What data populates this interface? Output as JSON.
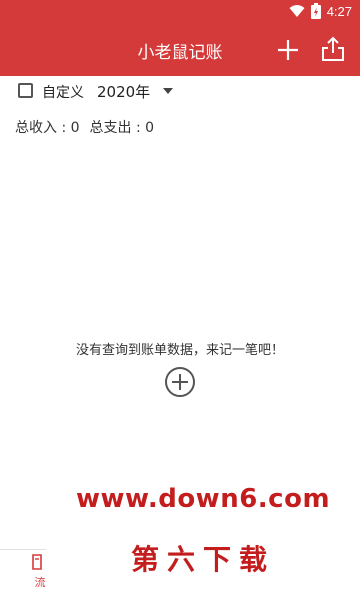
{
  "status_bar": {
    "time": "4:27",
    "battery_icon": "battery-charging-icon",
    "wifi_icon": "wifi-icon"
  },
  "app_bar": {
    "title": "小老鼠记账",
    "actions": [
      "add-icon",
      "share-upload-icon"
    ]
  },
  "filter": {
    "custom_label": "自定义",
    "year": "2020年",
    "checked": false
  },
  "summary": {
    "income": "总收入 : 0",
    "expense": "总支出 : 0"
  },
  "empty_state": {
    "message": "没有查询到账单数据，来记一笔吧！"
  },
  "bottom_nav": {
    "item_label": "流"
  },
  "watermark": {
    "line1": "www.down6.com",
    "line2": "第六下载"
  },
  "colors": {
    "primary": "#d53a3a",
    "watermark": "#c41d1d"
  }
}
